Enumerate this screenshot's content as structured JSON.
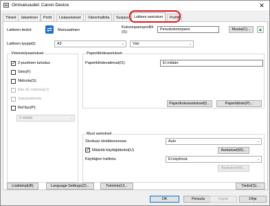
{
  "window": {
    "title": "Ominaisuudet: Canon Device",
    "close_label": "✕"
  },
  "tabs": [
    {
      "label": "Yleiset"
    },
    {
      "label": "Jakaminen"
    },
    {
      "label": "Portit"
    },
    {
      "label": "Lisäasetukset"
    },
    {
      "label": "Värienhallinta"
    },
    {
      "label": "Suojaus"
    },
    {
      "label": "Laitteen asetukset"
    },
    {
      "label": "Profiili"
    }
  ],
  "header": {
    "device_info_label": "Laitteen tiedot:",
    "device_info_mode": "Manuaalinen",
    "profile_label_line1": "Kokoonpanoprofiili",
    "profile_label_line2": "(S):",
    "profile_value": "Peruskokoonpano",
    "change_button": "Muuta(C)..."
  },
  "device_type": {
    "label": "Laitteen tyyppi(I):",
    "value": "A3",
    "color_value": "Väri"
  },
  "optional_settings": {
    "title": "Vimeistelyasetukset",
    "items": [
      {
        "label": "2-puolinen tulostus",
        "checked": true,
        "disabled": false
      },
      {
        "label": "Sirto(F)",
        "checked": false,
        "disabled": false
      },
      {
        "label": "Nidonta(S)",
        "checked": false,
        "disabled": false
      },
      {
        "label": "Eko (E nidonta)(J)",
        "checked": false,
        "disabled": true
      },
      {
        "label": "Satulanidonta",
        "checked": false,
        "disabled": true
      },
      {
        "label": "Rei'itys(P):",
        "checked": false,
        "disabled": false
      }
    ],
    "punch_select": "2 reikää"
  },
  "paper_source": {
    "title": "Paperilähdeasetukset",
    "option_label": "Paperilähdevalinnat(O):",
    "option_value": "Ei mitään",
    "paper_size_button": "Paperikokoasetukset(I)...",
    "paper_source_button": "Paperilähde(P)..."
  },
  "other_settings": {
    "title": "Muut asetukset",
    "rotation_label": "Sivoluas räntäkoneessa:",
    "rotation_value": "Auto",
    "user_settings_label": "Määritä käyttäjätiedot(U)",
    "user_settings_checked": true,
    "user_settings_button": "Asetukset(W)...",
    "user_management_label": "Käyttäjien hallinta:",
    "user_management_value": "Ei käytössä",
    "user_management_button": "Asetukset(N)..."
  },
  "footer_buttons": {
    "additional": "Lisätietojä(B)",
    "language": "Language Settings(Z)...",
    "function": "Toiminto(U)...",
    "info": "Tiedot(S)..."
  },
  "dialog_buttons": {
    "ok": "OK",
    "cancel": "Peruuta",
    "apply": "Käytä",
    "help": "Ohje"
  }
}
